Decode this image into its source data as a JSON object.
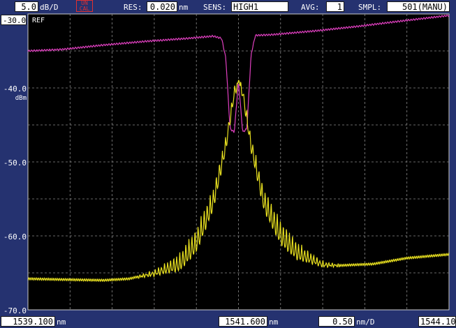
{
  "header": {
    "scale_value": "5.0",
    "scale_unit": "dB/D",
    "uncal_line1": "UN",
    "uncal_line2": "CAL",
    "res_label": "RES:",
    "res_value": "0.020",
    "res_unit": "nm",
    "sens_label": "SENS:",
    "sens_value": "HIGH1",
    "avg_label": "AVG:",
    "avg_value": "1",
    "smpl_label": "SMPL:",
    "smpl_value": "501(MANU)"
  },
  "ref": {
    "level": "-30.0",
    "label": "REF"
  },
  "y_axis": {
    "tick_labels": [
      "-40.0",
      "-50.0",
      "-60.0",
      "-70.0"
    ],
    "unit": "dBm"
  },
  "footer": {
    "start_value": "1539.100",
    "start_unit": "nm",
    "center_value": "1541.600",
    "center_unit": "nm",
    "span_value": "0.50",
    "span_unit": "nm/D",
    "stop_value": "1544.10"
  },
  "colors": {
    "background": "#253270",
    "plot_bg": "#000000",
    "grid": "#8a8a8a",
    "trace_a": "#e040c0",
    "trace_b": "#e8e020"
  },
  "chart_data": {
    "type": "line",
    "x_start": 1539.1,
    "x_stop": 1544.1,
    "x_center": 1541.6,
    "ylim": [
      -70,
      -30
    ],
    "grid": true,
    "series": [
      {
        "color": "#e040c0",
        "x": [
          1539.1,
          1539.5,
          1540.0,
          1540.5,
          1541.0,
          1541.3,
          1541.4,
          1541.45,
          1541.5,
          1541.55,
          1541.6,
          1541.65,
          1541.7,
          1541.75,
          1541.8,
          1542.0,
          1542.5,
          1543.0,
          1543.5,
          1544.1
        ],
        "values": [
          -35.0,
          -34.8,
          -34.2,
          -33.7,
          -33.3,
          -33.0,
          -33.3,
          -36.0,
          -45.5,
          -46.0,
          -39.0,
          -46.0,
          -45.5,
          -35.5,
          -32.9,
          -32.8,
          -32.3,
          -31.7,
          -31.0,
          -30.2
        ]
      },
      {
        "color": "#e8e020",
        "x": [
          1539.1,
          1539.5,
          1540.0,
          1540.3,
          1540.6,
          1540.9,
          1541.1,
          1541.3,
          1541.45,
          1541.55,
          1541.6,
          1541.65,
          1541.75,
          1541.9,
          1542.1,
          1542.3,
          1542.6,
          1542.8,
          1543.2,
          1543.6,
          1544.1
        ],
        "values": [
          -65.8,
          -65.9,
          -66.0,
          -65.8,
          -65.0,
          -63.5,
          -60.5,
          -55.0,
          -47.5,
          -40.5,
          -39.0,
          -40.5,
          -47.5,
          -55.0,
          -59.5,
          -62.0,
          -63.8,
          -64.0,
          -63.8,
          -63.0,
          -62.5
        ]
      }
    ]
  }
}
